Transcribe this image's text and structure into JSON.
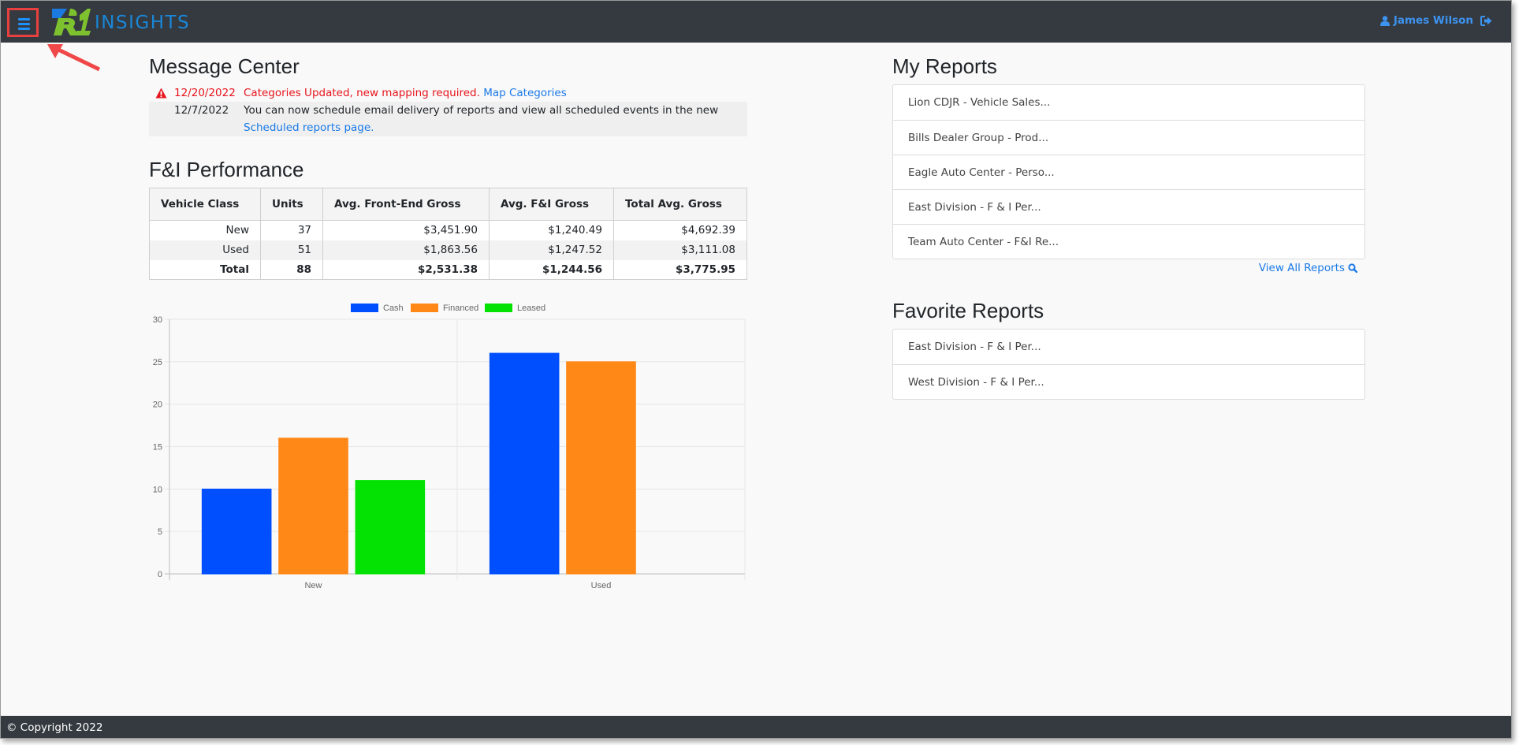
{
  "app": {
    "brand": "INSIGHTS",
    "brand_mark": "R1"
  },
  "header": {
    "menu_icon": "hamburger-icon",
    "user_icon": "user-icon",
    "user_name": "James Wilson",
    "logout_icon": "sign-out-icon"
  },
  "annotation": {
    "color": "#e8403f",
    "target": "hamburger-menu"
  },
  "message_center": {
    "title": "Message Center",
    "messages": [
      {
        "icon": "warning-icon",
        "date": "12/20/2022",
        "text": "Categories Updated, new mapping required.",
        "link": "Map Categories",
        "severity": "alert"
      },
      {
        "icon": "",
        "date": "12/7/2022",
        "text": "You can now schedule email delivery of reports and view all scheduled events in the new",
        "link": "Scheduled reports page.",
        "severity": "info"
      }
    ]
  },
  "fi_performance": {
    "title": "F&I Performance",
    "columns": [
      "Vehicle Class",
      "Units",
      "Avg. Front-End Gross",
      "Avg. F&I Gross",
      "Total Avg. Gross"
    ],
    "rows": [
      [
        "New",
        "37",
        "$3,451.90",
        "$1,240.49",
        "$4,692.39"
      ],
      [
        "Used",
        "51",
        "$1,863.56",
        "$1,247.52",
        "$3,111.08"
      ]
    ],
    "total": [
      "Total",
      "88",
      "$2,531.38",
      "$1,244.56",
      "$3,775.95"
    ]
  },
  "chart_data": {
    "type": "bar",
    "title": "",
    "categories": [
      "New",
      "Used"
    ],
    "series": [
      {
        "name": "Cash",
        "color": "#004ffe",
        "values": [
          10,
          26
        ]
      },
      {
        "name": "Financed",
        "color": "#ff8816",
        "values": [
          16,
          25
        ]
      },
      {
        "name": "Leased",
        "color": "#03e203",
        "values": [
          11,
          0
        ]
      }
    ],
    "xlabel": "",
    "ylabel": "",
    "ylim": [
      0,
      30
    ],
    "yticks": [
      0,
      5,
      10,
      15,
      20,
      25,
      30
    ],
    "grid": true,
    "legend": "top-center"
  },
  "my_reports": {
    "title": "My Reports",
    "items": [
      "Lion CDJR - Vehicle Sales...",
      "Bills Dealer Group - Prod...",
      "Eagle Auto Center - Perso...",
      "East Division - F & I Per...",
      "Team Auto Center - F&I Re..."
    ],
    "view_all": "View All Reports",
    "view_all_icon": "search-icon"
  },
  "favorite_reports": {
    "title": "Favorite Reports",
    "items": [
      "East Division - F & I Per...",
      "West Division - F & I Per..."
    ]
  },
  "footer": {
    "copyright": "© Copyright 2022"
  }
}
